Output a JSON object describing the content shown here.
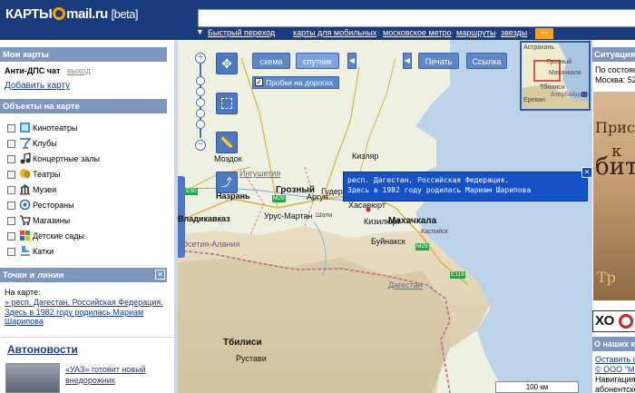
{
  "header": {
    "logo_text": "КАРТЫ",
    "logo_domain": "mail.ru",
    "logo_beta": "[beta]"
  },
  "nav": {
    "quick_nav": "Быстрый переход",
    "links": [
      "карты для мобильных",
      "московское метро",
      "маршруты",
      "звезды"
    ]
  },
  "sidebar": {
    "my_maps_title": "Мои карты",
    "my_map_name": "Анти-ДПС чат",
    "exit_label": "выход",
    "add_map_label": "Добавить карту",
    "objects_title": "Объекты на карте",
    "layers": [
      {
        "label": "Кинотеатры",
        "icon": "cinema-icon"
      },
      {
        "label": "Клубы",
        "icon": "cocktail-icon"
      },
      {
        "label": "Концертные залы",
        "icon": "note-icon"
      },
      {
        "label": "Театры",
        "icon": "masks-icon"
      },
      {
        "label": "Музеи",
        "icon": "museum-icon"
      },
      {
        "label": "Рестораны",
        "icon": "restaurant-icon"
      },
      {
        "label": "Магазины",
        "icon": "shopping-icon"
      },
      {
        "label": "Детские сады",
        "icon": "kindergarten-icon"
      },
      {
        "label": "Катки",
        "icon": "skates-icon"
      }
    ],
    "points_title": "Точки и линии",
    "on_map_label": "На карте:",
    "point_link_1": "» респ. Дагестан, Российская Федерация.",
    "point_link_2": "Здесь в 1982 году родилась Мариам",
    "point_link_3": "Шарипова",
    "news_title": "Автоновости",
    "news_item_1": "«УАЗ» готовит новый",
    "news_item_2": "внедорожник"
  },
  "map": {
    "btn_scheme": "схема",
    "btn_satellite": "спутник",
    "btn_print": "Печать",
    "btn_link": "Ссылка",
    "traffic_label": "Пробки на дорогах",
    "traffic_checked": true,
    "popup_line1": "респ. Дагестан, Российская Федерация.",
    "popup_line2": "Здесь в 1982 году родилась Мариам Шарипова",
    "popup_close": "×",
    "scale_label": "100 км",
    "cities": [
      {
        "name": "Грозный"
      },
      {
        "name": "Махачкала"
      },
      {
        "name": "Назрань"
      },
      {
        "name": "Кизляр"
      },
      {
        "name": "Тбилиси"
      },
      {
        "name": "Хасавюрт"
      },
      {
        "name": "Аргун"
      },
      {
        "name": "Гудермес"
      },
      {
        "name": "Урус-Мартан"
      },
      {
        "name": "Моздок"
      },
      {
        "name": "Кизилюрт"
      },
      {
        "name": "Буйнакск"
      },
      {
        "name": "Каспийск"
      },
      {
        "name": "Шали"
      },
      {
        "name": "Рустави"
      },
      {
        "name": "Владикавказ"
      },
      {
        "name": "Ингушетия"
      },
      {
        "name": "Осетия-Алания"
      },
      {
        "name": "Дагестан"
      }
    ],
    "minimap_labels": [
      "Астрахань",
      "Грозный",
      "Махачкала",
      "Тбилиси",
      "Ереван",
      "Азербайджан"
    ]
  },
  "rightcol": {
    "situation_title": "Ситуация",
    "situation_line1": "По состоян",
    "situation_line2": "Москва: 52",
    "ad_text_1": "Присо",
    "ad_text_2": "к",
    "ad_text_3": "бит",
    "ad_text_4": "Тр",
    "ad_logo": "ХО",
    "about_title": "О наших к",
    "about_link": "Оставить с",
    "about_line2": "© ООО \"Ма",
    "about_line3": "Навигация б",
    "about_line4": "абонентско"
  }
}
